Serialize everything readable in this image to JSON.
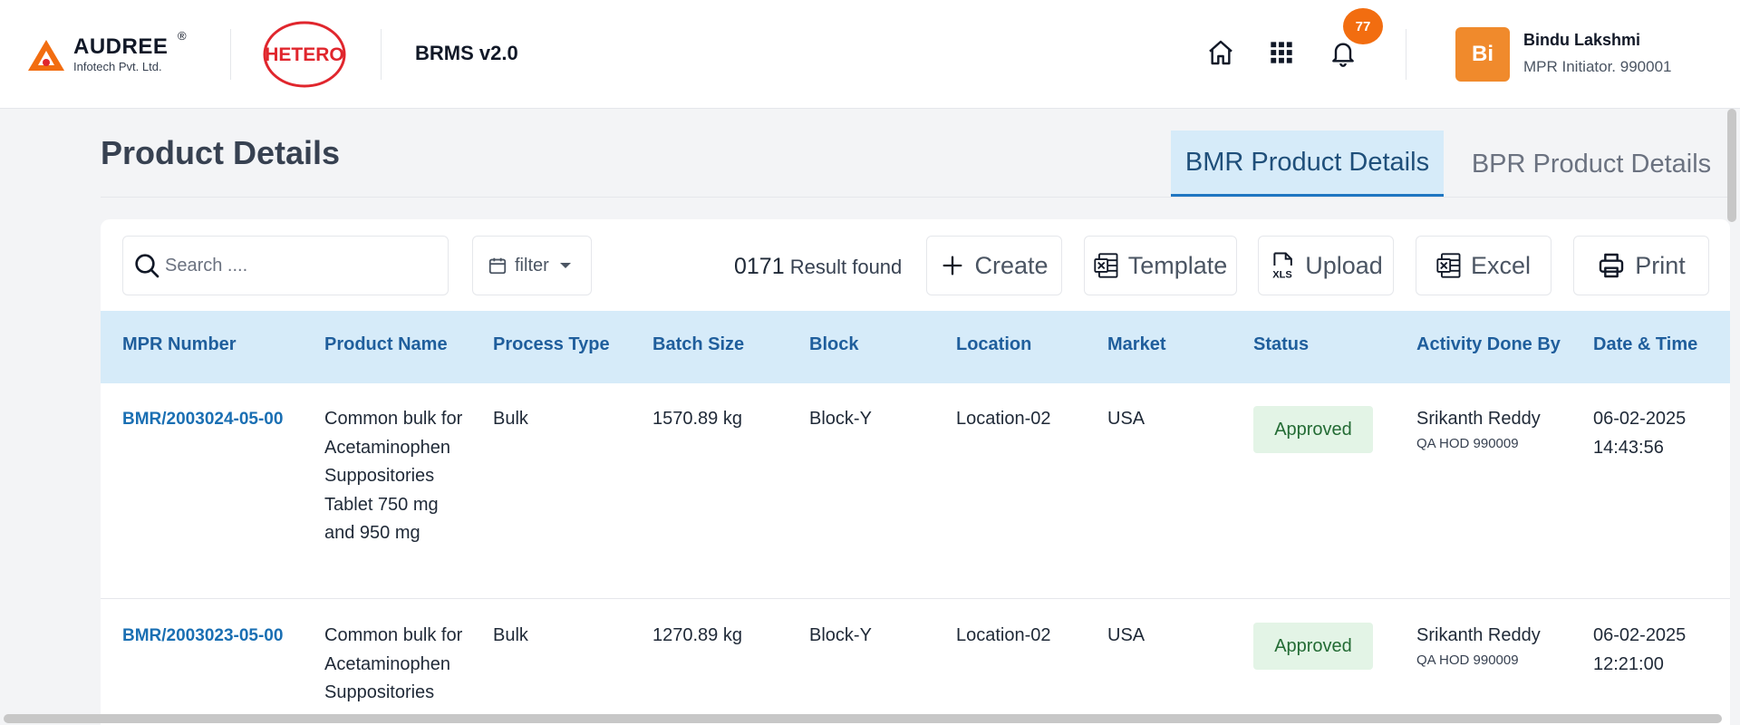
{
  "header": {
    "brand_name": "AUDREE",
    "brand_reg": "®",
    "brand_sub": "Infotech Pvt. Ltd.",
    "partner_logo_text": "HETERO",
    "app_name": "BRMS v2.0",
    "icons": [
      "home-icon",
      "apps-grid-icon",
      "bell-icon"
    ],
    "notification_count": "77",
    "user": {
      "initials": "Bi",
      "name": "Bindu Lakshmi",
      "role": "MPR Initiator. 990001"
    },
    "colors": {
      "brand_orange": "#f26d10",
      "avatar": "#f08a2c",
      "logo_red": "#e0262d"
    }
  },
  "page": {
    "title": "Product Details",
    "tabs": [
      {
        "label": "BMR Product Details",
        "active": true
      },
      {
        "label": "BPR Product Details",
        "active": false
      }
    ]
  },
  "toolbar": {
    "search_placeholder": "Search ....",
    "filter_label": "filter",
    "result_count": "0171",
    "result_text": "Result found",
    "create_label": "Create",
    "template_label": "Template",
    "upload_label": "Upload",
    "excel_label": "Excel",
    "print_label": "Print"
  },
  "table": {
    "columns": [
      "MPR Number",
      "Product Name",
      "Process Type",
      "Batch Size",
      "Block",
      "Location",
      "Market",
      "Status",
      "Activity Done By",
      "Date & Time"
    ],
    "rows": [
      {
        "mpr_number": "BMR/2003024-05-00",
        "product_name": "Common bulk for Acetaminophen Suppositories Tablet 750 mg and 950 mg",
        "process_type": "Bulk",
        "batch_size": "1570.89 kg",
        "block": "Block-Y",
        "location": "Location-02",
        "market": "USA",
        "status": "Approved",
        "activity_by": "Srikanth Reddy",
        "activity_role": "QA HOD 990009",
        "date": "06-02-2025",
        "time": "14:43:56"
      },
      {
        "mpr_number": "BMR/2003023-05-00",
        "product_name": "Common bulk for Acetaminophen Suppositories",
        "process_type": "Bulk",
        "batch_size": "1270.89 kg",
        "block": "Block-Y",
        "location": "Location-02",
        "market": "USA",
        "status": "Approved",
        "activity_by": "Srikanth Reddy",
        "activity_role": "QA HOD 990009",
        "date": "06-02-2025",
        "time": "12:21:00"
      }
    ]
  }
}
